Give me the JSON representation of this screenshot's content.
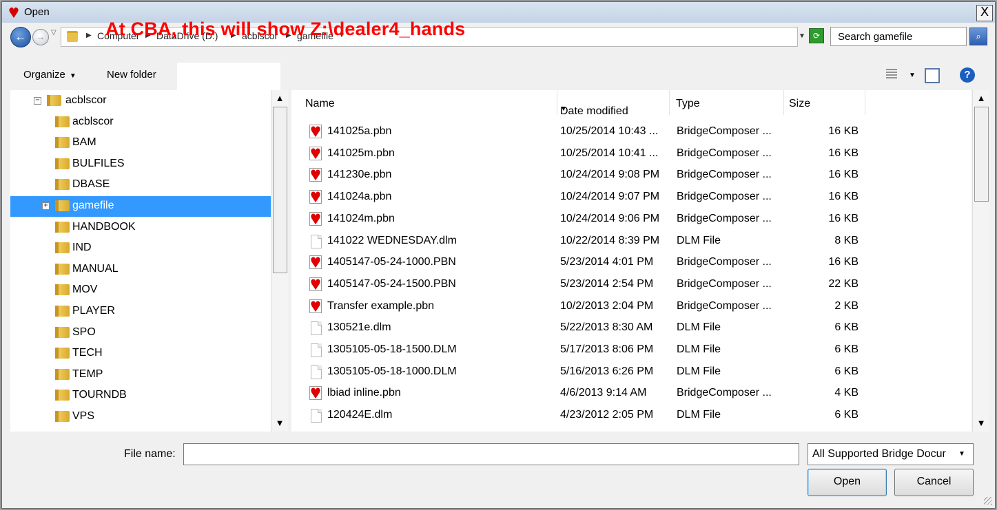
{
  "window": {
    "title": "Open",
    "close_glyph": "X"
  },
  "address": {
    "crumbs": [
      "Computer",
      "DataDrive (D:)",
      "acblscor",
      "gamefile"
    ],
    "annotation": "At CBA, this will show   Z:\\dealer4_hands"
  },
  "search": {
    "placeholder": "Search gamefile"
  },
  "toolbar": {
    "organize": "Organize",
    "new_folder": "New folder"
  },
  "tree": {
    "items": [
      {
        "label": "acblscor",
        "expander": "⊟"
      },
      {
        "label": "acblscor"
      },
      {
        "label": "BAM"
      },
      {
        "label": "BULFILES"
      },
      {
        "label": "DBASE"
      },
      {
        "label": "gamefile",
        "expander": "⊞",
        "selected": true
      },
      {
        "label": "HANDBOOK"
      },
      {
        "label": "IND"
      },
      {
        "label": "MANUAL"
      },
      {
        "label": "MOV"
      },
      {
        "label": "PLAYER"
      },
      {
        "label": "SPO"
      },
      {
        "label": "TECH"
      },
      {
        "label": "TEMP"
      },
      {
        "label": "TOURNDB"
      },
      {
        "label": "VPS"
      }
    ]
  },
  "columns": {
    "name": "Name",
    "date": "Date modified",
    "type": "Type",
    "size": "Size"
  },
  "files": [
    {
      "name": "141025a.pbn",
      "date": "10/25/2014 10:43 ...",
      "type": "BridgeComposer ...",
      "size": "16 KB",
      "icon": "pbn"
    },
    {
      "name": "141025m.pbn",
      "date": "10/25/2014 10:41 ...",
      "type": "BridgeComposer ...",
      "size": "16 KB",
      "icon": "pbn"
    },
    {
      "name": "141230e.pbn",
      "date": "10/24/2014 9:08 PM",
      "type": "BridgeComposer ...",
      "size": "16 KB",
      "icon": "pbn"
    },
    {
      "name": "141024a.pbn",
      "date": "10/24/2014 9:07 PM",
      "type": "BridgeComposer ...",
      "size": "16 KB",
      "icon": "pbn"
    },
    {
      "name": "141024m.pbn",
      "date": "10/24/2014 9:06 PM",
      "type": "BridgeComposer ...",
      "size": "16 KB",
      "icon": "pbn"
    },
    {
      "name": "141022 WEDNESDAY.dlm",
      "date": "10/22/2014 8:39 PM",
      "type": "DLM File",
      "size": "8 KB",
      "icon": "dlm"
    },
    {
      "name": "1405147-05-24-1000.PBN",
      "date": "5/23/2014 4:01 PM",
      "type": "BridgeComposer ...",
      "size": "16 KB",
      "icon": "pbn"
    },
    {
      "name": "1405147-05-24-1500.PBN",
      "date": "5/23/2014 2:54 PM",
      "type": "BridgeComposer ...",
      "size": "22 KB",
      "icon": "pbn"
    },
    {
      "name": "Transfer example.pbn",
      "date": "10/2/2013 2:04 PM",
      "type": "BridgeComposer ...",
      "size": "2 KB",
      "icon": "pbn"
    },
    {
      "name": "130521e.dlm",
      "date": "5/22/2013 8:30 AM",
      "type": "DLM File",
      "size": "6 KB",
      "icon": "dlm"
    },
    {
      "name": "1305105-05-18-1500.DLM",
      "date": "5/17/2013 8:06 PM",
      "type": "DLM File",
      "size": "6 KB",
      "icon": "dlm"
    },
    {
      "name": "1305105-05-18-1000.DLM",
      "date": "5/16/2013 6:26 PM",
      "type": "DLM File",
      "size": "6 KB",
      "icon": "dlm"
    },
    {
      "name": "lbiad inline.pbn",
      "date": "4/6/2013 9:14 AM",
      "type": "BridgeComposer ...",
      "size": "4 KB",
      "icon": "pbn"
    },
    {
      "name": "120424E.dlm",
      "date": "4/23/2012 2:05 PM",
      "type": "DLM File",
      "size": "6 KB",
      "icon": "dlm"
    }
  ],
  "footer": {
    "file_name_label": "File name:",
    "file_name_value": "",
    "file_type": "All Supported Bridge Docur",
    "open_label": "Open",
    "cancel_label": "Cancel"
  },
  "colors": {
    "selection": "#3399ff",
    "annotation": "#ff0000",
    "pbn_icon": "#e00000"
  }
}
